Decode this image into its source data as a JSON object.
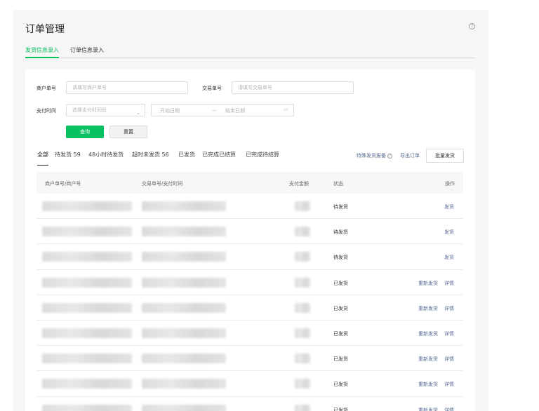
{
  "page": {
    "title": "订单管理"
  },
  "tabs": [
    {
      "label": "发货信息录入"
    },
    {
      "label": "订单信息录入"
    }
  ],
  "form": {
    "merchant_order_label": "商户单号",
    "merchant_order_placeholder": "请填写商户单号",
    "transaction_label": "交易单号",
    "transaction_placeholder": "请填写交易单号",
    "pay_time_label": "支付时间",
    "pay_time_select": "选择支付时间段",
    "start_date": "开始日期",
    "range_sep": "—",
    "end_date": "结束日期",
    "query_button": "查询",
    "reset_button": "重置"
  },
  "filters": [
    {
      "label": "全部"
    },
    {
      "label": "待发货 59"
    },
    {
      "label": "48小时待发货"
    },
    {
      "label": "超时未发货 56"
    },
    {
      "label": "已发货"
    },
    {
      "label": "已完成已结算"
    },
    {
      "label": "已完成待结算"
    }
  ],
  "toolbar": {
    "special_report": "特殊发货报备",
    "export": "导出订单",
    "batch_ship": "批量发货"
  },
  "table": {
    "columns": [
      "商户单号/商户号",
      "交易单号/支付时间",
      "支付金额",
      "状态",
      "操作"
    ],
    "rows": [
      {
        "status": "待发货",
        "actions": [
          "发货"
        ]
      },
      {
        "status": "待发货",
        "actions": [
          "发货"
        ]
      },
      {
        "status": "待发货",
        "actions": [
          "发货"
        ]
      },
      {
        "status": "已发货",
        "actions": [
          "重新发货",
          "详情"
        ]
      },
      {
        "status": "已发货",
        "actions": [
          "重新发货",
          "详情"
        ]
      },
      {
        "status": "已发货",
        "actions": [
          "重新发货",
          "详情"
        ]
      },
      {
        "status": "已发货",
        "actions": [
          "重新发货",
          "详情"
        ]
      },
      {
        "status": "已发货",
        "actions": [
          "重新发货",
          "详情"
        ]
      },
      {
        "status": "已发货",
        "actions": [
          "重新发货",
          "详情"
        ]
      }
    ]
  },
  "colors": {
    "accent": "#07c160",
    "link": "#576b95"
  }
}
